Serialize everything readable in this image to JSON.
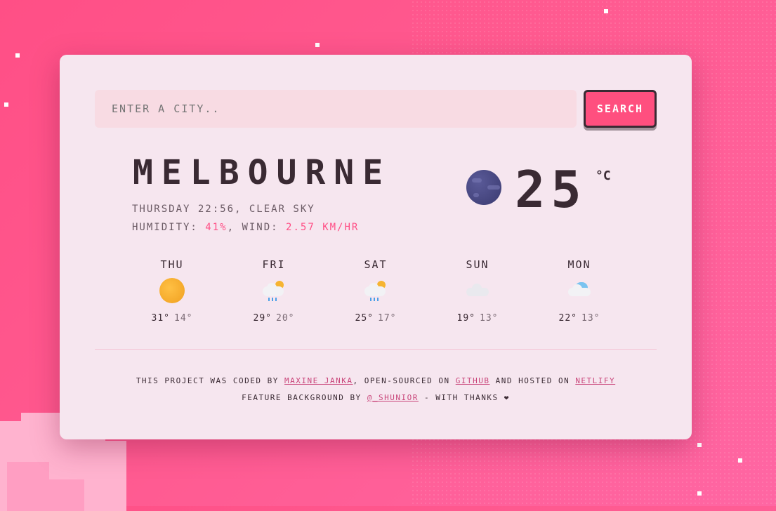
{
  "search": {
    "placeholder": "ENTER A CITY..",
    "button_label": "SEARCH"
  },
  "current": {
    "city": "MELBOURNE",
    "description": "THURSDAY 22:56, CLEAR SKY",
    "humidity_label": "HUMIDITY:",
    "humidity_value": "41%",
    "wind_label": ", WIND:",
    "wind_value": "2.57 KM/HR",
    "icon": "moon-icon",
    "temperature": "25",
    "unit": "°C"
  },
  "forecast": [
    {
      "day": "THU",
      "icon": "sun-icon",
      "high": "31°",
      "low": "14°"
    },
    {
      "day": "FRI",
      "icon": "sun-cloud-rain-icon",
      "high": "29°",
      "low": "20°"
    },
    {
      "day": "SAT",
      "icon": "sun-cloud-rain-icon",
      "high": "25°",
      "low": "17°"
    },
    {
      "day": "SUN",
      "icon": "cloud-icon",
      "high": "19°",
      "low": "13°"
    },
    {
      "day": "MON",
      "icon": "cloud-icon",
      "high": "22°",
      "low": "13°"
    }
  ],
  "credits": {
    "line1_prefix": "THIS PROJECT WAS CODED BY",
    "author": "MAXINE JANKA",
    "line1_mid": ", OPEN-SOURCED ON",
    "github": "GITHUB",
    "line1_mid2": "AND HOSTED ON",
    "netlify": "NETLIFY",
    "line2_prefix": "FEATURE BACKGROUND BY",
    "bg_artist": "@_SHUNIOR",
    "line2_suffix": "- WITH THANKS ❤"
  },
  "colors": {
    "accent": "#ff4f86",
    "card": "#f6e6ef",
    "text": "#3a2a33"
  }
}
